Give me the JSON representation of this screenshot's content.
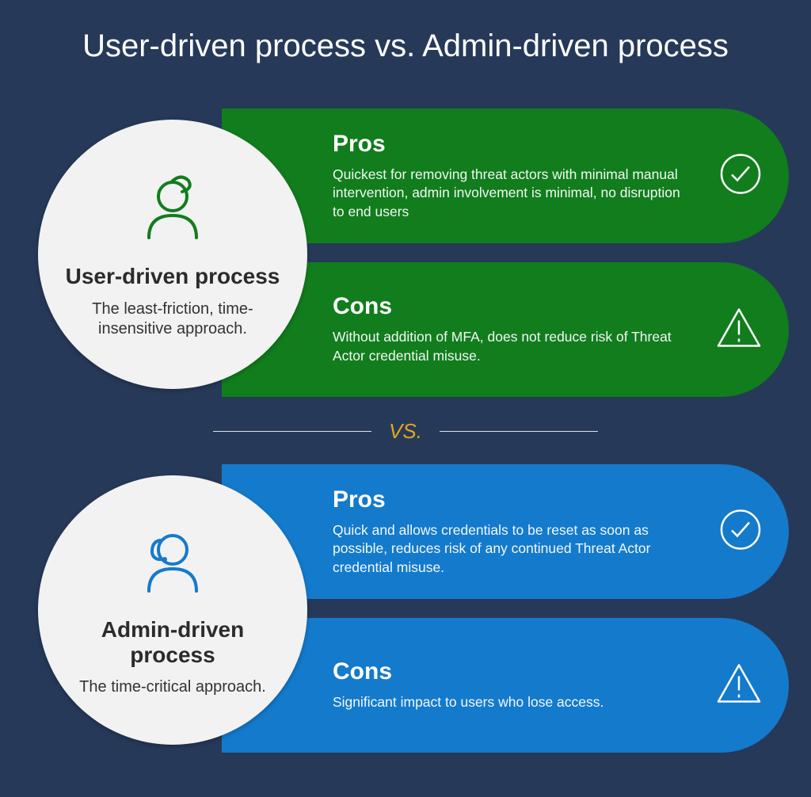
{
  "title": "User-driven process vs. Admin-driven process",
  "vs": {
    "label": "VS."
  },
  "colors": {
    "bg": "#263959",
    "green": "#117d1d",
    "blue": "#147acc",
    "circle_bg": "#f2f2f2",
    "vs_text": "#e3a71a"
  },
  "user": {
    "icon": "user-person-icon",
    "icon_color": "#117d1d",
    "title": "User-driven process",
    "subtitle": "The least-friction, time-insensitive approach.",
    "pros": {
      "label": "Pros",
      "body": "Quickest for removing threat actors with minimal manual intervention, admin involvement is minimal, no disruption to end users",
      "icon": "check-circle-icon"
    },
    "cons": {
      "label": "Cons",
      "body": "Without addition of MFA, does not reduce risk of Threat Actor credential misuse.",
      "icon": "warning-triangle-icon"
    }
  },
  "admin": {
    "icon": "admin-headset-icon",
    "icon_color": "#147acc",
    "title": "Admin-driven process",
    "subtitle": "The time-critical approach.",
    "pros": {
      "label": "Pros",
      "body": "Quick and allows credentials to be reset as soon as possible, reduces risk of any continued Threat Actor credential misuse.",
      "icon": "check-circle-icon"
    },
    "cons": {
      "label": "Cons",
      "body": "Significant impact to users who lose access.",
      "icon": "warning-triangle-icon"
    }
  }
}
